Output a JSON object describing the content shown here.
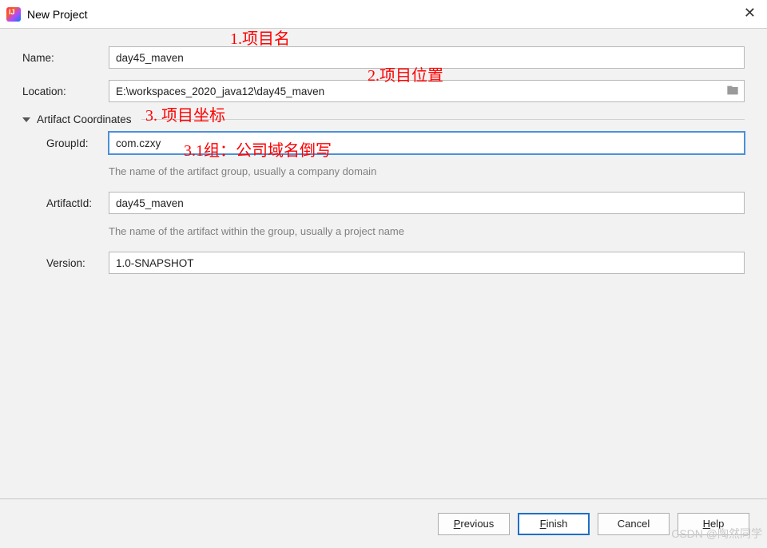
{
  "window": {
    "title": "New Project"
  },
  "form": {
    "name_label": "Name:",
    "name_value": "day45_maven",
    "location_label": "Location:",
    "location_value": "E:\\workspaces_2020_java12\\day45_maven"
  },
  "artifact": {
    "section_title": "Artifact Coordinates",
    "groupid_label": "GroupId:",
    "groupid_value": "com.czxy",
    "groupid_hint": "The name of the artifact group, usually a company domain",
    "artifactid_label": "ArtifactId:",
    "artifactid_value": "day45_maven",
    "artifactid_hint": "The name of the artifact within the group, usually a project name",
    "version_label": "Version:",
    "version_value": "1.0-SNAPSHOT"
  },
  "annotations": {
    "a1": "1.项目名",
    "a2": "2.项目位置",
    "a3": "3. 项目坐标",
    "a31": "3.1组：公司域名倒写"
  },
  "buttons": {
    "previous": "Previous",
    "finish": "Finish",
    "cancel": "Cancel",
    "help": "Help"
  },
  "watermark": "CSDN @陶然同学"
}
